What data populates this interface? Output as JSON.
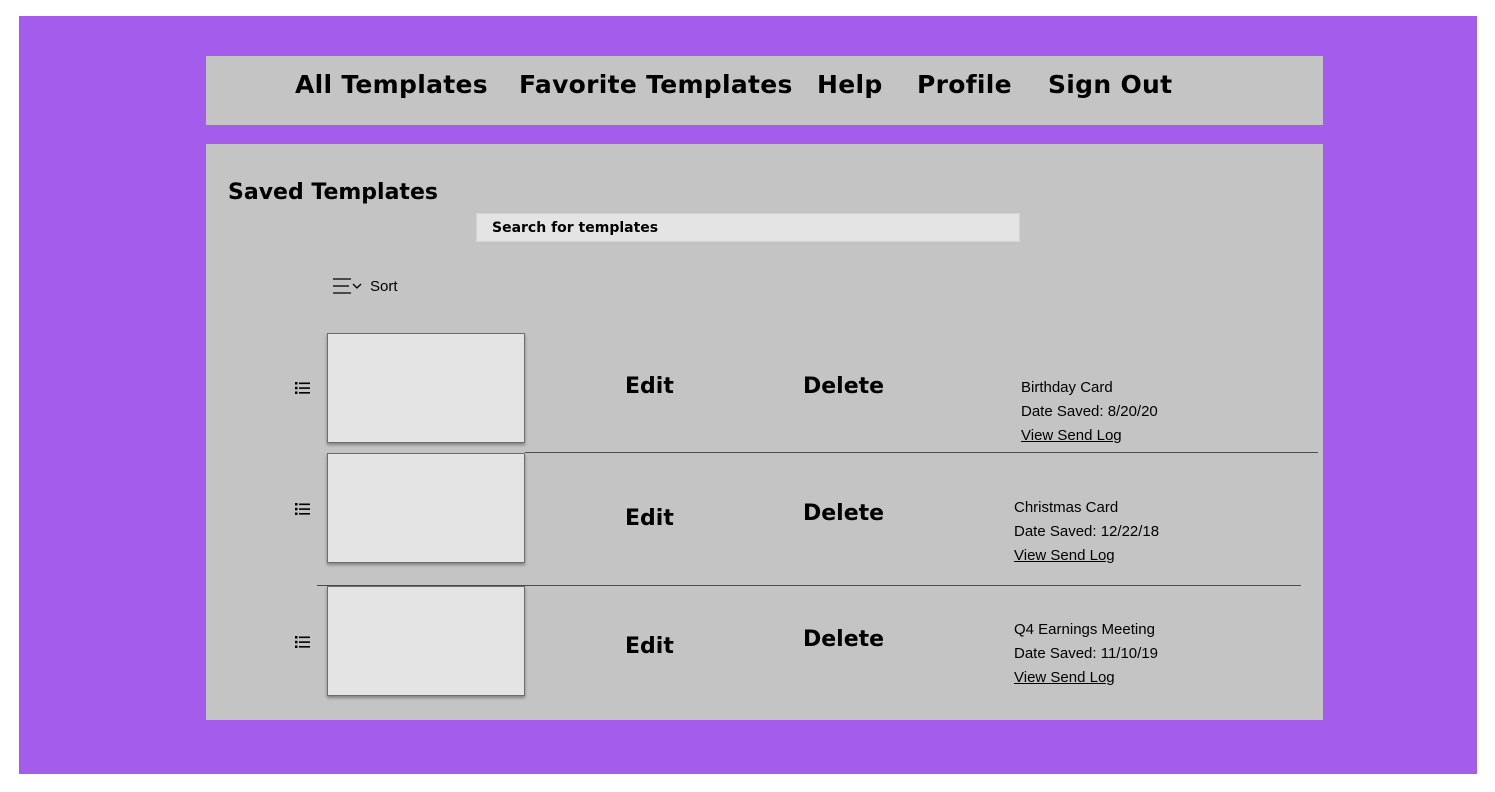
{
  "nav": {
    "items": [
      {
        "label": "All Templates"
      },
      {
        "label": "Favorite Templates"
      },
      {
        "label": "Help"
      },
      {
        "label": "Profile"
      },
      {
        "label": "Sign Out"
      }
    ]
  },
  "main": {
    "title": "Saved Templates",
    "search": {
      "placeholder": "Search for templates",
      "value": ""
    },
    "sort": {
      "label": "Sort",
      "icon": "sort-icon"
    },
    "templates": [
      {
        "name": "Birthday Card",
        "date_saved": "Date Saved: 8/20/20",
        "edit_label": "Edit",
        "delete_label": "Delete",
        "send_log_label": "View Send Log"
      },
      {
        "name": "Christmas Card",
        "date_saved": "Date Saved: 12/22/18",
        "edit_label": "Edit",
        "delete_label": "Delete",
        "send_log_label": "View Send Log"
      },
      {
        "name": "Q4 Earnings Meeting",
        "date_saved": "Date Saved: 11/10/19",
        "edit_label": "Edit",
        "delete_label": "Delete",
        "send_log_label": "View Send Log"
      }
    ],
    "row_icon": "drag-list-icon"
  },
  "colors": {
    "frame_background": "#a35ceb",
    "panel_background": "#c4c4c4",
    "field_background": "#e4e4e4"
  }
}
